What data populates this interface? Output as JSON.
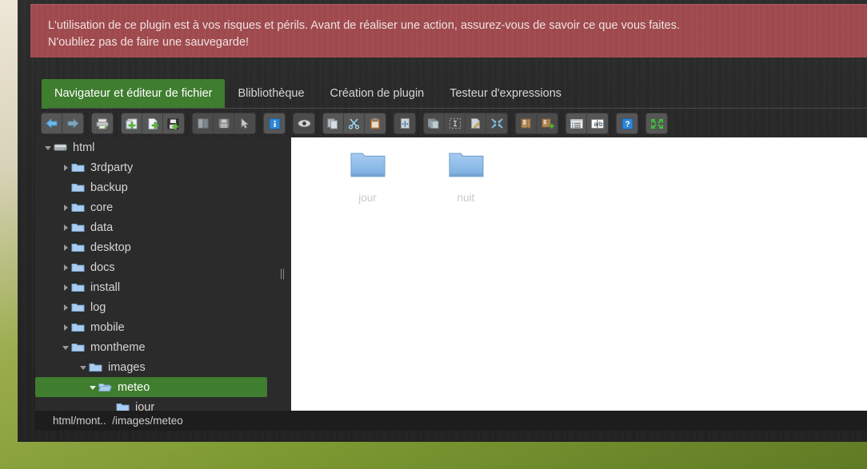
{
  "warning": {
    "line1": "L'utilisation de ce plugin est à vos risques et périls. Avant de réaliser une action, assurez-vous de savoir ce que vous faites.",
    "line2": "N'oubliez pas de faire une sauvegarde!",
    "background_color": "#a04a4e"
  },
  "tabs": [
    {
      "label": "Navigateur et éditeur de fichier",
      "active": true
    },
    {
      "label": "Blibliothèque",
      "active": false
    },
    {
      "label": "Création de plugin",
      "active": false
    },
    {
      "label": "Testeur d'expressions",
      "active": false
    }
  ],
  "accent_color": "#3f7d2f",
  "toolbar": {
    "groups": [
      {
        "buttons": [
          {
            "icon": "back-arrow-icon",
            "label": "Précédent"
          },
          {
            "icon": "forward-arrow-icon",
            "label": "Suivant"
          }
        ]
      },
      {
        "buttons": [
          {
            "icon": "printer-icon",
            "label": "Imprimer"
          }
        ]
      },
      {
        "buttons": [
          {
            "icon": "new-folder-icon",
            "label": "Nouveau dossier"
          },
          {
            "icon": "new-file-icon",
            "label": "Nouveau fichier"
          },
          {
            "icon": "save-add-icon",
            "label": "Enregistrer sous"
          }
        ]
      },
      {
        "buttons": [
          {
            "icon": "book-icon",
            "label": "Bibliothèque"
          },
          {
            "icon": "save-icon",
            "label": "Enregistrer"
          },
          {
            "icon": "cursor-icon",
            "label": "Sélection"
          }
        ]
      },
      {
        "buttons": [
          {
            "icon": "info-icon",
            "label": "Informations"
          }
        ]
      },
      {
        "buttons": [
          {
            "icon": "eye-icon",
            "label": "Aperçu"
          }
        ]
      },
      {
        "buttons": [
          {
            "icon": "copy-icon",
            "label": "Copier"
          },
          {
            "icon": "cut-scissors-icon",
            "label": "Couper"
          },
          {
            "icon": "paste-clipboard-icon",
            "label": "Coller"
          }
        ]
      },
      {
        "buttons": [
          {
            "icon": "move-file-icon",
            "label": "Déplacer"
          }
        ]
      },
      {
        "buttons": [
          {
            "icon": "duplicate-icon",
            "label": "Dupliquer"
          },
          {
            "icon": "select-all-icon",
            "label": "Tout sélectionner"
          },
          {
            "icon": "rename-icon",
            "label": "Renommer"
          },
          {
            "icon": "collapse-icon",
            "label": "Réduire"
          }
        ]
      },
      {
        "buttons": [
          {
            "icon": "archive-icon",
            "label": "Archiver"
          },
          {
            "icon": "archive-add-icon",
            "label": "Ajouter à l'archive"
          }
        ]
      },
      {
        "buttons": [
          {
            "icon": "list-icon",
            "label": "Liste"
          },
          {
            "icon": "translate-icon",
            "label": "Traduire"
          }
        ]
      },
      {
        "buttons": [
          {
            "icon": "help-icon",
            "label": "Aide"
          }
        ]
      },
      {
        "buttons": [
          {
            "icon": "fullscreen-icon",
            "label": "Plein écran"
          }
        ]
      }
    ]
  },
  "tree": {
    "items": [
      {
        "label": "html",
        "depth": 0,
        "icon": "drive-icon",
        "twisty": "open",
        "selected": false
      },
      {
        "label": "3rdparty",
        "depth": 1,
        "icon": "folder-icon",
        "twisty": "closed",
        "selected": false
      },
      {
        "label": "backup",
        "depth": 1,
        "icon": "folder-icon",
        "twisty": "none",
        "selected": false
      },
      {
        "label": "core",
        "depth": 1,
        "icon": "folder-icon",
        "twisty": "closed",
        "selected": false
      },
      {
        "label": "data",
        "depth": 1,
        "icon": "folder-icon",
        "twisty": "closed",
        "selected": false
      },
      {
        "label": "desktop",
        "depth": 1,
        "icon": "folder-icon",
        "twisty": "closed",
        "selected": false
      },
      {
        "label": "docs",
        "depth": 1,
        "icon": "folder-icon",
        "twisty": "closed",
        "selected": false
      },
      {
        "label": "install",
        "depth": 1,
        "icon": "folder-icon",
        "twisty": "closed",
        "selected": false
      },
      {
        "label": "log",
        "depth": 1,
        "icon": "folder-icon",
        "twisty": "closed",
        "selected": false
      },
      {
        "label": "mobile",
        "depth": 1,
        "icon": "folder-icon",
        "twisty": "closed",
        "selected": false
      },
      {
        "label": "montheme",
        "depth": 1,
        "icon": "folder-icon",
        "twisty": "open",
        "selected": false
      },
      {
        "label": "images",
        "depth": 2,
        "icon": "folder-icon",
        "twisty": "open",
        "selected": false
      },
      {
        "label": "meteo",
        "depth": 3,
        "icon": "folder-open-icon",
        "twisty": "open",
        "selected": true
      },
      {
        "label": "jour",
        "depth": 4,
        "icon": "folder-icon",
        "twisty": "none",
        "selected": false
      }
    ]
  },
  "files": {
    "items": [
      {
        "label": "jour",
        "icon": "folder-icon"
      },
      {
        "label": "nuit",
        "icon": "folder-icon"
      }
    ]
  },
  "status": {
    "path": "html/mont..  /images/meteo"
  }
}
